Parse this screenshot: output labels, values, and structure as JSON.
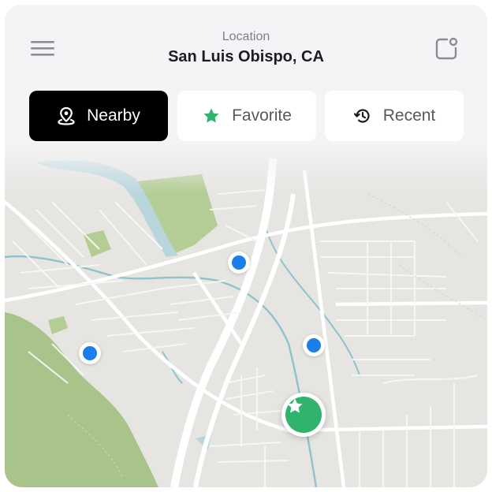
{
  "header": {
    "location_label": "Location",
    "location_value": "San Luis Obispo, CA",
    "menu_icon": "hamburger-menu-icon",
    "notification_icon": "notification-icon"
  },
  "tabs": [
    {
      "label": "Nearby",
      "icon": "location-pin-icon",
      "active": true
    },
    {
      "label": "Favorite",
      "icon": "star-icon",
      "active": false
    },
    {
      "label": "Recent",
      "icon": "history-icon",
      "active": false
    }
  ],
  "map": {
    "markers": [
      "nearby-marker",
      "nearby-marker",
      "nearby-marker"
    ],
    "favorite_marker_icon": "star-icon"
  },
  "colors": {
    "active_tab": "#000000",
    "marker_blue": "#1a7fe8",
    "favorite_green": "#2fb36d",
    "park_green": "#a9c48a",
    "water": "#b9d6dc"
  }
}
